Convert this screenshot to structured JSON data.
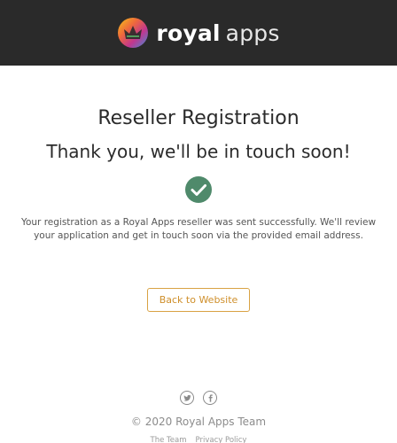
{
  "header": {
    "brand_bold": "royal",
    "brand_light": "apps",
    "logo_icon": "royal-apps-crown-logo"
  },
  "main": {
    "title": "Reseller Registration",
    "subtitle": "Thank you, we'll be in touch soon!",
    "success_icon": "check-circle",
    "success_color": "#4f8a6b",
    "message": "Your registration as a Royal Apps reseller was sent successfully. We'll review your application and get in touch soon via the provided email address.",
    "back_button": "Back to Website",
    "accent_color": "#d9a244"
  },
  "footer": {
    "social": [
      {
        "icon": "twitter-icon"
      },
      {
        "icon": "facebook-icon"
      }
    ],
    "copyright": "© 2020 Royal Apps Team",
    "links": [
      "The Team",
      "Privacy Policy"
    ]
  }
}
